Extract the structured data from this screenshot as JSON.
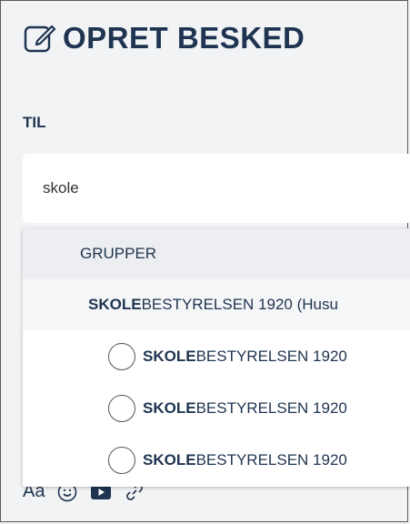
{
  "header": {
    "title": "OPRET BESKED",
    "icon": "edit-message-icon"
  },
  "recipient": {
    "label": "TIL",
    "search_value": "skole"
  },
  "dropdown": {
    "section_title": "GRUPPER",
    "group": {
      "match": "SKOLE",
      "rest": "BESTYRELSEN 1920 (Husu"
    },
    "options": [
      {
        "match": "SKOLE",
        "rest": "BESTYRELSEN 1920"
      },
      {
        "match": "SKOLE",
        "rest": "BESTYRELSEN 1920"
      },
      {
        "match": "SKOLE",
        "rest": "BESTYRELSEN 1920"
      }
    ]
  },
  "toolbar": {
    "format_label": "Aa",
    "icons": [
      "emoji-icon",
      "video-icon",
      "link-icon"
    ]
  }
}
